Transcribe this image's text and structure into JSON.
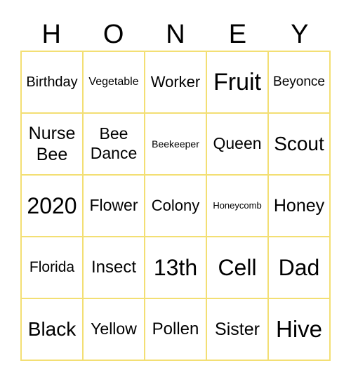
{
  "header": [
    "H",
    "O",
    "N",
    "E",
    "Y"
  ],
  "cells": [
    {
      "t": "Birthday",
      "s": 20
    },
    {
      "t": "Vegetable",
      "s": 16
    },
    {
      "t": "Worker",
      "s": 22
    },
    {
      "t": "Fruit",
      "s": 34
    },
    {
      "t": "Beyonce",
      "s": 19
    },
    {
      "t": "Nurse Bee",
      "s": 25
    },
    {
      "t": "Bee Dance",
      "s": 23
    },
    {
      "t": "Beekeeper",
      "s": 14
    },
    {
      "t": "Queen",
      "s": 23
    },
    {
      "t": "Scout",
      "s": 28
    },
    {
      "t": "2020",
      "s": 32
    },
    {
      "t": "Flower",
      "s": 23
    },
    {
      "t": "Colony",
      "s": 22
    },
    {
      "t": "Honeycomb",
      "s": 13
    },
    {
      "t": "Honey",
      "s": 25
    },
    {
      "t": "Florida",
      "s": 21
    },
    {
      "t": "Insect",
      "s": 24
    },
    {
      "t": "13th",
      "s": 32
    },
    {
      "t": "Cell",
      "s": 32
    },
    {
      "t": "Dad",
      "s": 32
    },
    {
      "t": "Black",
      "s": 28
    },
    {
      "t": "Yellow",
      "s": 23
    },
    {
      "t": "Pollen",
      "s": 24
    },
    {
      "t": "Sister",
      "s": 25
    },
    {
      "t": "Hive",
      "s": 33
    }
  ]
}
